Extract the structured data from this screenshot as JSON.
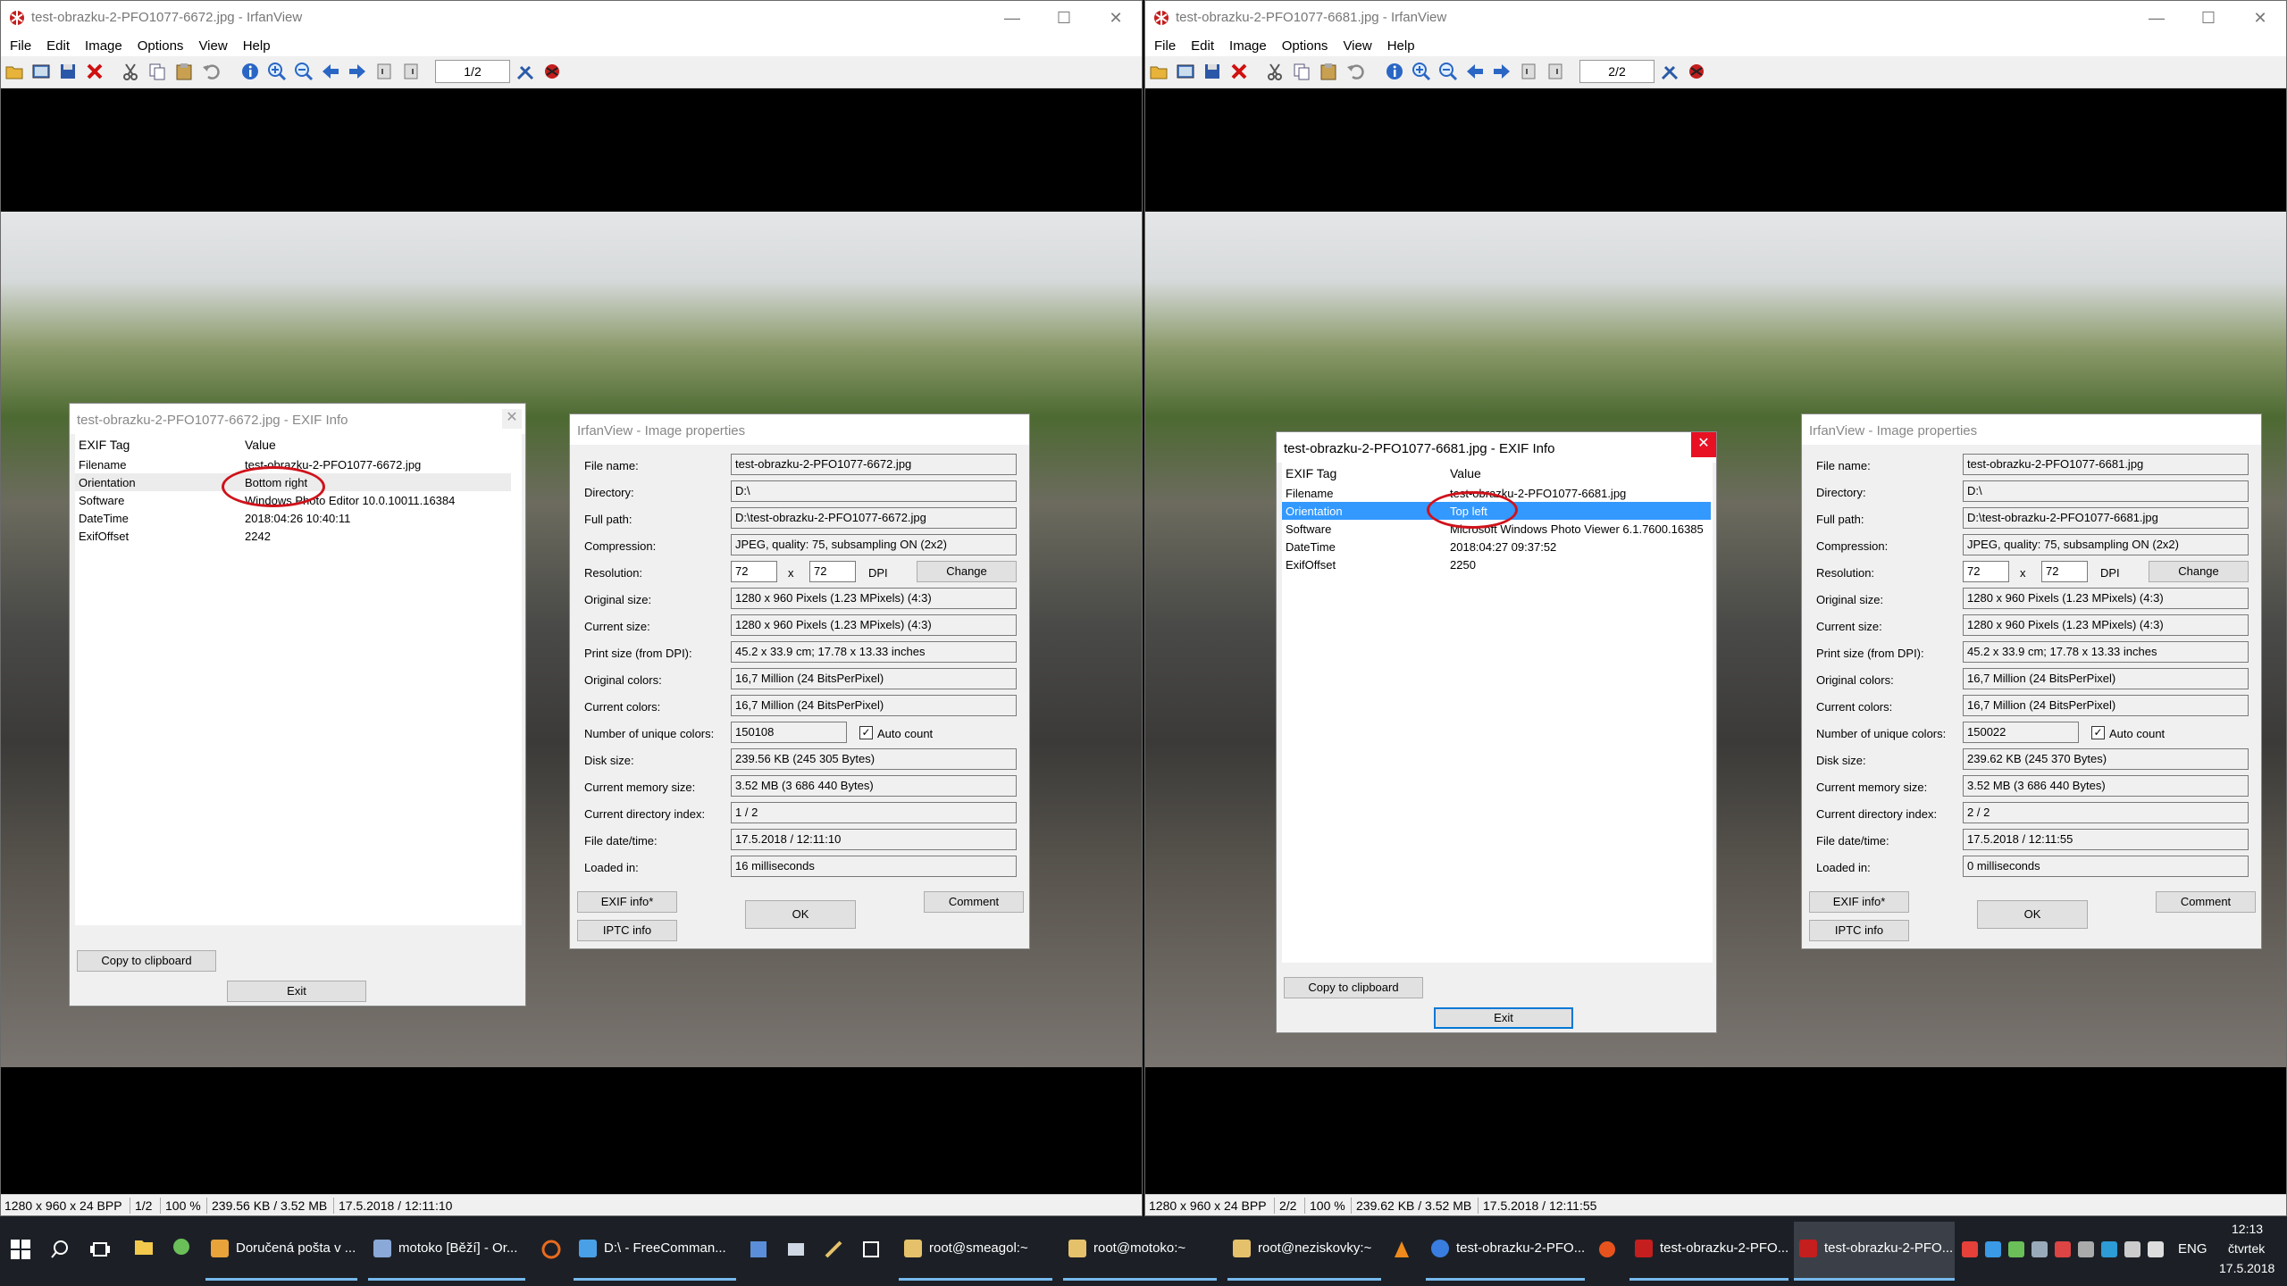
{
  "app": {
    "menu": [
      "File",
      "Edit",
      "Image",
      "Options",
      "View",
      "Help"
    ],
    "window_buttons": {
      "minimize": "—",
      "maximize": "☐",
      "close": "✕"
    }
  },
  "left_window": {
    "title": "test-obrazku-2-PFO1077-6672.jpg - IrfanView",
    "page_box": "1/2",
    "status": {
      "dimensions": "1280 x 960 x 24 BPP",
      "page": "1/2",
      "zoom": "100 %",
      "size": "239.56 KB / 3.52 MB",
      "datetime": "17.5.2018 / 12:11:10"
    },
    "exif": {
      "title": "test-obrazku-2-PFO1077-6672.jpg - EXIF Info",
      "close": "✕",
      "col_tag": "EXIF Tag",
      "col_value": "Value",
      "rows": [
        {
          "tag": "Filename",
          "value": "test-obrazku-2-PFO1077-6672.jpg"
        },
        {
          "tag": "Orientation",
          "value": "Bottom right"
        },
        {
          "tag": "Software",
          "value": "Windows Photo Editor 10.0.10011.16384"
        },
        {
          "tag": "DateTime",
          "value": "2018:04:26 10:40:11"
        },
        {
          "tag": "ExifOffset",
          "value": "2242"
        }
      ],
      "copy_button": "Copy to clipboard",
      "exit_button": "Exit"
    },
    "props": {
      "title": "IrfanView - Image properties",
      "file_name": "test-obrazku-2-PFO1077-6672.jpg",
      "directory": "D:\\",
      "full_path": "D:\\test-obrazku-2-PFO1077-6672.jpg",
      "compression": "JPEG, quality: 75, subsampling ON (2x2)",
      "dpi_x": "72",
      "dpi_y": "72",
      "original_size": "1280 x 960  Pixels (1.23 MPixels) (4:3)",
      "current_size": "1280 x 960  Pixels (1.23 MPixels) (4:3)",
      "print_size": "45.2 x 33.9 cm; 17.78 x 13.33 inches",
      "original_colors": "16,7 Million   (24 BitsPerPixel)",
      "current_colors": "16,7 Million   (24 BitsPerPixel)",
      "unique_colors": "150108",
      "disk_size": "239.56 KB (245 305 Bytes)",
      "memory_size": "3.52  MB (3 686 440 Bytes)",
      "dir_index": "1  /  2",
      "file_datetime": "17.5.2018 / 12:11:10",
      "loaded_in": "16 milliseconds"
    }
  },
  "right_window": {
    "title": "test-obrazku-2-PFO1077-6681.jpg - IrfanView",
    "page_box": "2/2",
    "status": {
      "dimensions": "1280 x 960 x 24 BPP",
      "page": "2/2",
      "zoom": "100 %",
      "size": "239.62 KB / 3.52 MB",
      "datetime": "17.5.2018 / 12:11:55"
    },
    "exif": {
      "title": "test-obrazku-2-PFO1077-6681.jpg - EXIF Info",
      "close": "✕",
      "col_tag": "EXIF Tag",
      "col_value": "Value",
      "rows": [
        {
          "tag": "Filename",
          "value": "test-obrazku-2-PFO1077-6681.jpg"
        },
        {
          "tag": "Orientation",
          "value": "Top left"
        },
        {
          "tag": "Software",
          "value": "Microsoft Windows Photo Viewer 6.1.7600.16385"
        },
        {
          "tag": "DateTime",
          "value": "2018:04:27 09:37:52"
        },
        {
          "tag": "ExifOffset",
          "value": "2250"
        }
      ],
      "copy_button": "Copy to clipboard",
      "exit_button": "Exit"
    },
    "props": {
      "title": "IrfanView - Image properties",
      "file_name": "test-obrazku-2-PFO1077-6681.jpg",
      "directory": "D:\\",
      "full_path": "D:\\test-obrazku-2-PFO1077-6681.jpg",
      "compression": "JPEG, quality: 75, subsampling ON (2x2)",
      "dpi_x": "72",
      "dpi_y": "72",
      "original_size": "1280 x 960  Pixels (1.23 MPixels) (4:3)",
      "current_size": "1280 x 960  Pixels (1.23 MPixels) (4:3)",
      "print_size": "45.2 x 33.9 cm; 17.78 x 13.33 inches",
      "original_colors": "16,7 Million   (24 BitsPerPixel)",
      "current_colors": "16,7 Million   (24 BitsPerPixel)",
      "unique_colors": "150022",
      "disk_size": "239.62 KB (245 370 Bytes)",
      "memory_size": "3.52  MB (3 686 440 Bytes)",
      "dir_index": "2  /  2",
      "file_datetime": "17.5.2018 / 12:11:55",
      "loaded_in": "0 milliseconds"
    }
  },
  "props_labels": {
    "file_name": "File name:",
    "directory": "Directory:",
    "full_path": "Full path:",
    "compression": "Compression:",
    "resolution": "Resolution:",
    "x": "x",
    "dpi": "DPI",
    "change": "Change",
    "original_size": "Original size:",
    "current_size": "Current size:",
    "print_size": "Print size (from DPI):",
    "original_colors": "Original colors:",
    "current_colors": "Current colors:",
    "unique_colors": "Number of unique colors:",
    "auto_count": "Auto count",
    "disk_size": "Disk size:",
    "memory_size": "Current memory size:",
    "dir_index": "Current directory index:",
    "file_datetime": "File date/time:",
    "loaded_in": "Loaded in:",
    "exif_info": "EXIF info*",
    "iptc_info": "IPTC info",
    "ok": "OK",
    "comment": "Comment"
  },
  "taskbar": {
    "items": [
      {
        "label": "Doručená pošta v ..."
      },
      {
        "label": "motoko [Běží] - Or..."
      },
      {
        "label": "D:\\ - FreeComman..."
      },
      {
        "label": "root@smeagol:~"
      },
      {
        "label": "root@motoko:~"
      },
      {
        "label": "root@neziskovky:~"
      },
      {
        "label": "test-obrazku-2-PFO..."
      },
      {
        "label": "test-obrazku-2-PFO..."
      },
      {
        "label": "test-obrazku-2-PFO..."
      }
    ],
    "lang": "ENG",
    "time": "12:13",
    "day": "čtvrtek",
    "date": "17.5.2018"
  },
  "colors": {
    "selection": "#3399ff",
    "annotation": "#d0121b",
    "taskbar": "#1c2026",
    "accent": "#0078d7"
  }
}
